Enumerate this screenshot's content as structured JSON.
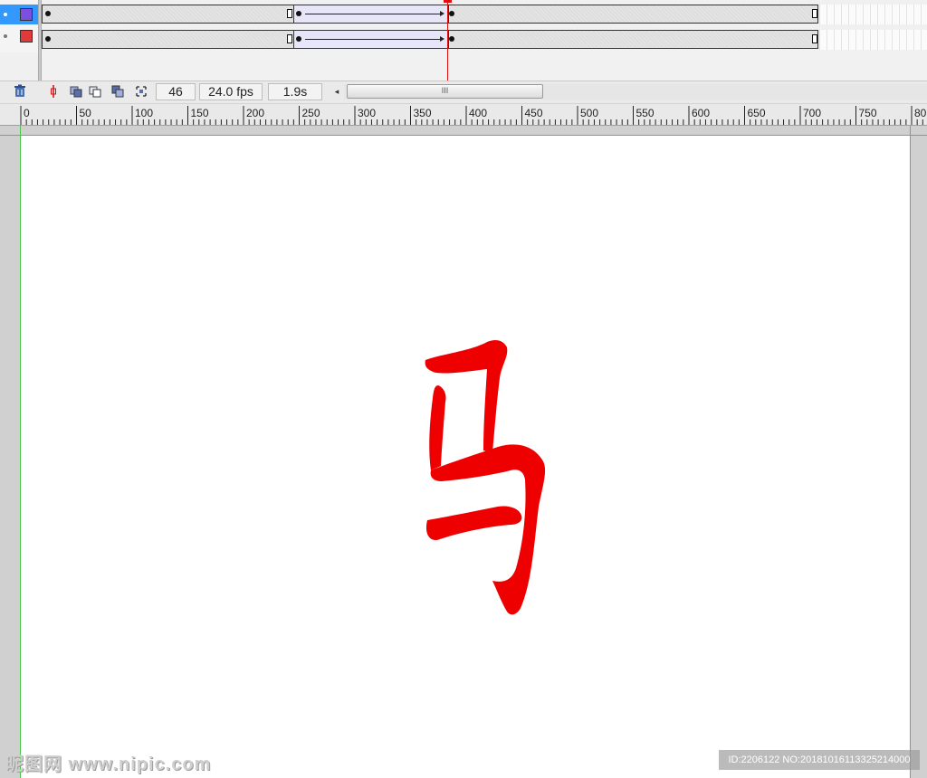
{
  "timeline": {
    "layers": [
      {
        "color": "#7b4fe0",
        "selected": true
      },
      {
        "color": "#e03b3b",
        "selected": false
      }
    ],
    "frame_number": "46",
    "frame_rate": "24.0 fps",
    "elapsed_time": "1.9s",
    "scroll_left_glyph": "◂",
    "scroll_thumb_grip": "III"
  },
  "ruler": {
    "labels": [
      "0",
      "50",
      "100",
      "150",
      "200",
      "250",
      "300",
      "350",
      "400",
      "450",
      "500",
      "550",
      "600",
      "650",
      "700",
      "750",
      "80"
    ]
  },
  "stage": {
    "character": "马",
    "character_color": "#ee0000",
    "guide_color": "#46c846"
  },
  "watermarks": {
    "left": "昵图网 www.nipic.com",
    "right": "ID:2206122 NO:20181016113325214000"
  },
  "icons": {
    "trash": "trash-icon",
    "playhead": "center-frame-icon",
    "onion_skin": "onion-skin-icon",
    "onion_outline": "onion-skin-outline-icon",
    "edit_multiple": "edit-multiple-frames-icon",
    "modify_markers": "modify-onion-markers-icon"
  }
}
